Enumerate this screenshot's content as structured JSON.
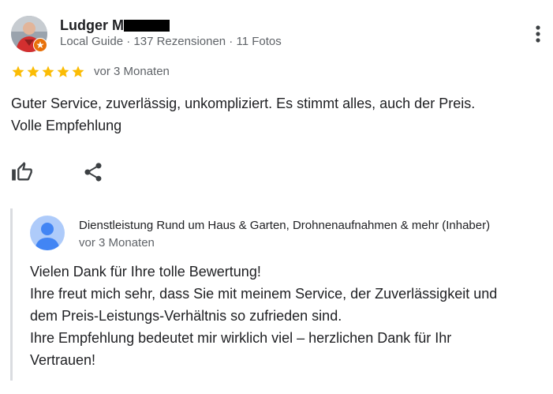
{
  "reviewer": {
    "name": "Ludger M",
    "meta": "Local Guide · 137 Rezensionen · 11 Fotos"
  },
  "rating": {
    "stars": 5,
    "max": 5,
    "date": "vor 3 Monaten",
    "star_color": "#fbbc04"
  },
  "review": {
    "lines": [
      "Guter Service, zuverlässig, unkompliziert. Es stimmt alles, auch der Preis.",
      "Volle Empfehlung"
    ]
  },
  "actions": {
    "like_icon": "thumb-up-icon",
    "share_icon": "share-icon",
    "more_icon": "more-vert-icon"
  },
  "owner_reply": {
    "name": "Dienstleistung Rund um Haus & Garten, Drohnenaufnahmen & mehr (Inhaber)",
    "date": "vor 3 Monaten",
    "lines": [
      "Vielen Dank für Ihre tolle Bewertung!",
      "Ihre freut mich sehr, dass Sie mit meinem Service, der Zuverlässigkeit und",
      "dem Preis-Leistungs-Verhältnis so zufrieden sind.",
      "Ihre Empfehlung bedeutet mir wirklich viel – herzlichen Dank für Ihr",
      "Vertrauen!"
    ]
  }
}
